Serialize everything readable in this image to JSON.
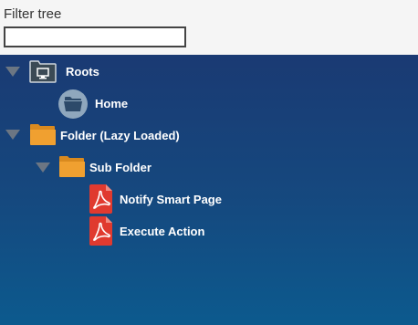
{
  "filter": {
    "label": "Filter tree",
    "value": "",
    "placeholder": ""
  },
  "tree": {
    "nodes": [
      {
        "label": "Roots",
        "icon": "monitor-folder-icon",
        "expanded": true
      },
      {
        "label": "Home",
        "icon": "home-folder-icon"
      },
      {
        "label": "Folder (Lazy Loaded)",
        "icon": "folder-icon",
        "expanded": true
      },
      {
        "label": "Sub Folder",
        "icon": "folder-icon",
        "expanded": true
      },
      {
        "label": "Notify Smart Page",
        "icon": "pdf-icon"
      },
      {
        "label": "Execute Action",
        "icon": "pdf-icon"
      }
    ]
  },
  "colors": {
    "tree_background_top": "#1a3a73",
    "tree_background_bottom": "#0c5a8e",
    "folder": "#f0a030",
    "pdf": "#e03a2f",
    "toggle": "#6c7683"
  }
}
